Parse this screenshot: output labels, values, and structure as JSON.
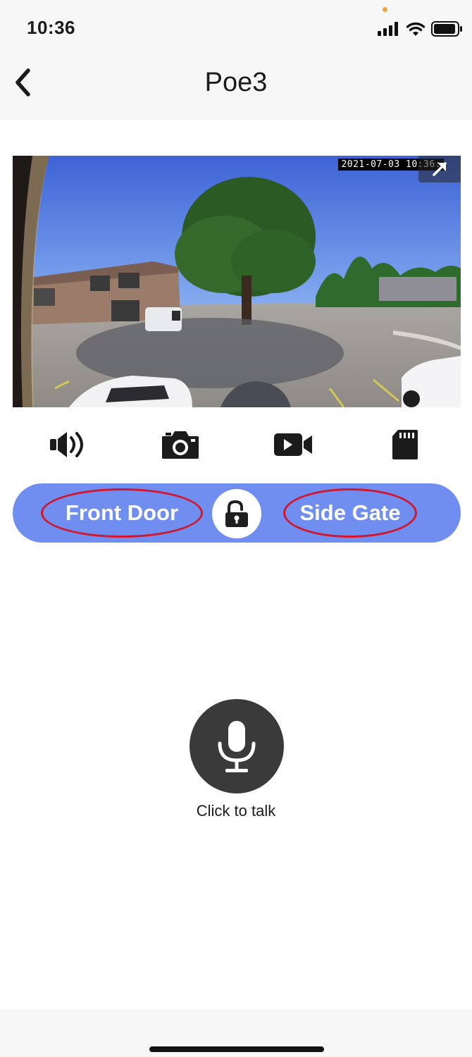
{
  "status_bar": {
    "time": "10:36",
    "icons": [
      "cellular-signal-icon",
      "wifi-icon",
      "battery-icon"
    ]
  },
  "nav": {
    "title": "Poe3",
    "back_icon": "chevron-left-icon"
  },
  "camera": {
    "timestamp": "2021-07-03 10:36:",
    "fullscreen_icon": "expand-arrow-icon"
  },
  "toolbar": {
    "items": [
      "speaker-icon",
      "camera-snapshot-icon",
      "video-record-icon",
      "sd-card-icon"
    ]
  },
  "doors": {
    "left_label": "Front Door",
    "right_label": "Side Gate",
    "lock_icon": "unlocked-padlock-icon",
    "highlight_color": "#d4162c",
    "bar_color": "#6f8ef0"
  },
  "talk": {
    "label": "Click to talk",
    "icon": "microphone-icon"
  }
}
